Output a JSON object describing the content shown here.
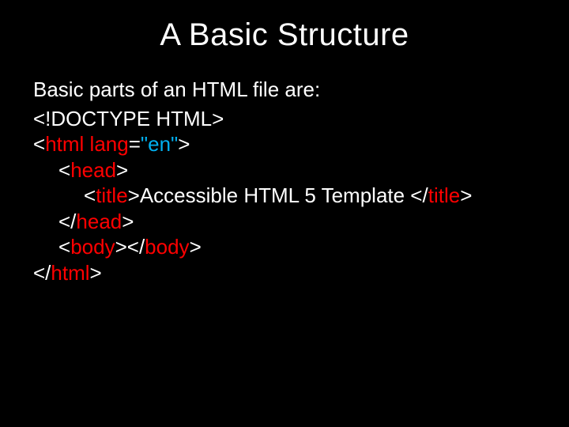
{
  "title": "A Basic Structure",
  "intro": "Basic parts of an HTML file are:",
  "code": {
    "l1": "<!DOCTYPE HTML>",
    "l2a": "<",
    "l2b": "html",
    "l2c": " lang",
    "l2d": "=",
    "l2e": "\"en\"",
    "l2f": ">",
    "l3a": "<",
    "l3b": "head",
    "l3c": ">",
    "l4a": "<",
    "l4b": "title",
    "l4c": ">Accessible HTML 5 Template </",
    "l4d": "title",
    "l4e": ">",
    "l5a": "</",
    "l5b": "head",
    "l5c": ">",
    "l6a": "<",
    "l6b": "body",
    "l6c": "></",
    "l6d": "body",
    "l6e": ">",
    "l7a": "</",
    "l7b": "html",
    "l7c": ">"
  }
}
